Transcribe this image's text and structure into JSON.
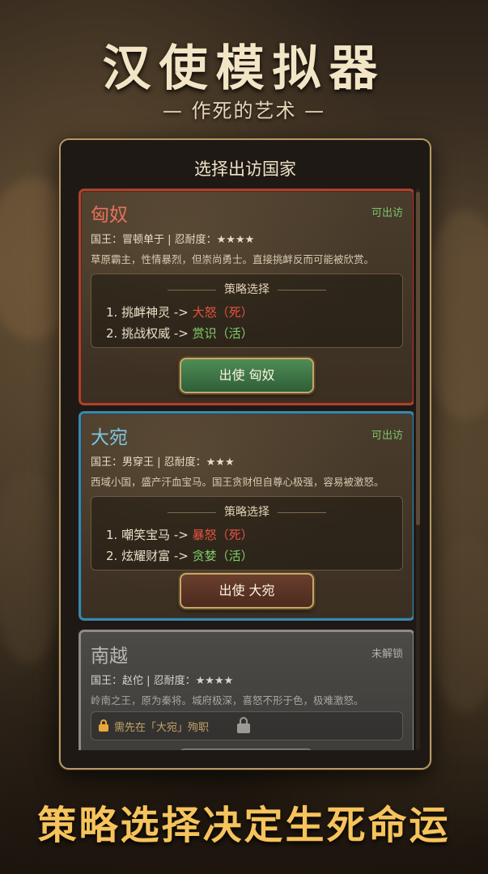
{
  "header": {
    "title": "汉使模拟器",
    "subtitle": "— 作死的艺术 —"
  },
  "panel": {
    "title": "选择出访国家"
  },
  "countries": [
    {
      "name": "匈奴",
      "status": "可出访",
      "king_line": "国王：冒顿单于 | 忍耐度：★★★★",
      "desc": "草原霸主，性情暴烈，但崇尚勇士。直接挑衅反而可能被欣赏。",
      "strategy_title": "策略选择",
      "options": [
        {
          "prefix": "1. 挑衅神灵 -> ",
          "result": "大怒（死）"
        },
        {
          "prefix": "2. 挑战权威 -> ",
          "result": "赏识（活）"
        }
      ],
      "button": "出使 匈奴"
    },
    {
      "name": "大宛",
      "status": "可出访",
      "king_line": "国王：男穿王 | 忍耐度：★★★",
      "desc": "西域小国，盛产汗血宝马。国王贪财但自尊心极强，容易被激怒。",
      "strategy_title": "策略选择",
      "options": [
        {
          "prefix": "1. 嘲笑宝马 -> ",
          "result": "暴怒（死）"
        },
        {
          "prefix": "2. 炫耀财富 -> ",
          "result": "贪婪（活）"
        }
      ],
      "button": "出使 大宛"
    },
    {
      "name": "南越",
      "status": "未解锁",
      "king_line": "国王：赵佗 | 忍耐度：★★★★",
      "desc": "岭南之王，原为秦将。城府极深，喜怒不形于色，极难激怒。",
      "lock_text": "需先在「大宛」殉职"
    }
  ],
  "tagline": "策略选择决定生死命运",
  "colors": {
    "accent_gold": "#f6c35c",
    "death_red": "#e6533f",
    "live_green": "#7ed069",
    "border_red": "#a8432f",
    "border_blue": "#3f86a8"
  }
}
